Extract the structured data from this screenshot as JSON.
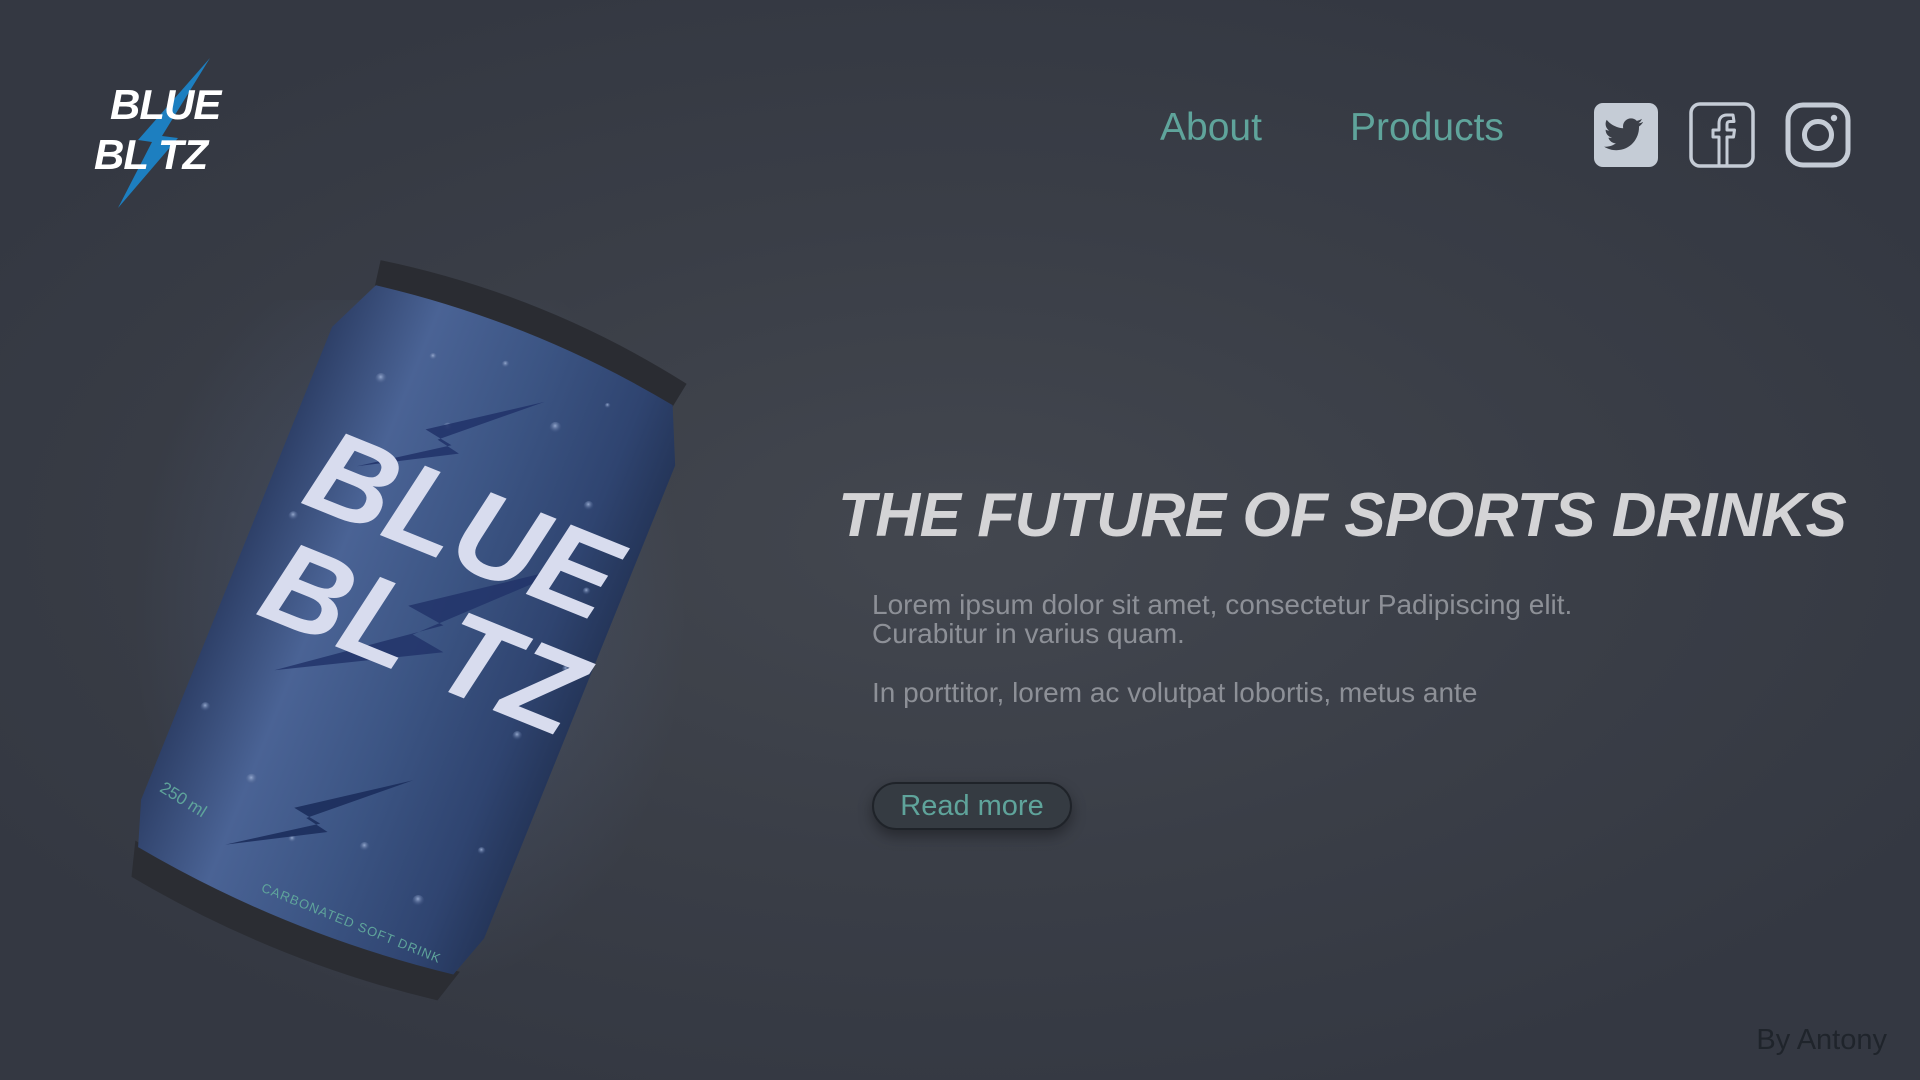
{
  "brand": {
    "logo_line1": "BLUE",
    "logo_line2": "BL TZ",
    "accent_color": "#1d7fc0"
  },
  "nav": {
    "items": [
      {
        "label": "About"
      },
      {
        "label": "Products"
      }
    ],
    "link_color": "#5fa49b"
  },
  "social": [
    "twitter-icon",
    "facebook-icon",
    "instagram-icon"
  ],
  "product": {
    "can_label_line1": "BLUE",
    "can_label_line2": "BL TZ",
    "volume": "250 ml",
    "type": "CARBONATED SOFT DRINK",
    "can_color": "#3c5584"
  },
  "hero": {
    "headline": "THE FUTURE OF SPORTS DRINKS",
    "paragraph1": "Lorem ipsum dolor sit amet, consectetur Padipiscing elit. Curabitur in varius quam.",
    "paragraph2": "In porttitor, lorem ac volutpat  lobortis, metus ante",
    "cta_label": "Read more"
  },
  "footer": {
    "byline": "By Antony"
  }
}
